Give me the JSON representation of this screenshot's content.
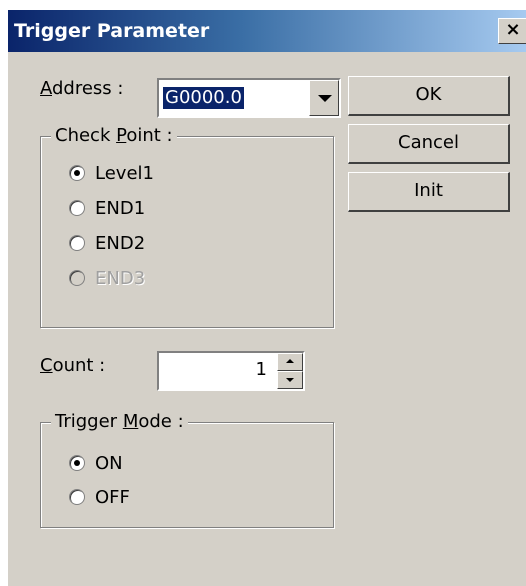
{
  "dialog": {
    "title": "Trigger Parameter",
    "close_glyph": "×"
  },
  "address": {
    "label_u": "A",
    "label_rest": "ddress :",
    "value": "G0000.0"
  },
  "buttons": {
    "ok": "OK",
    "cancel": "Cancel",
    "init": "Init"
  },
  "check_point": {
    "title_pre": "Check ",
    "title_u": "P",
    "title_post": "oint :",
    "options": [
      {
        "label": "Level1",
        "checked": true,
        "enabled": true
      },
      {
        "label": "END1",
        "checked": false,
        "enabled": true
      },
      {
        "label": "END2",
        "checked": false,
        "enabled": true
      },
      {
        "label": "END3",
        "checked": false,
        "enabled": false
      }
    ]
  },
  "count": {
    "label_u": "C",
    "label_rest": "ount :",
    "value": "1"
  },
  "trigger_mode": {
    "title_pre": "Trigger ",
    "title_u": "M",
    "title_post": "ode :",
    "options": [
      {
        "label": "ON",
        "checked": true,
        "enabled": true
      },
      {
        "label": "OFF",
        "checked": false,
        "enabled": true
      }
    ]
  },
  "icons": {
    "close": "close-icon",
    "dropdown": "chevron-down-icon",
    "spin_up": "arrow-up-icon",
    "spin_down": "arrow-down-icon"
  },
  "colors": {
    "title_bar_start": "#0a246a",
    "title_bar_end": "#a6caf0",
    "dialog_face": "#d4d0c8",
    "selection": "#0a246a"
  }
}
